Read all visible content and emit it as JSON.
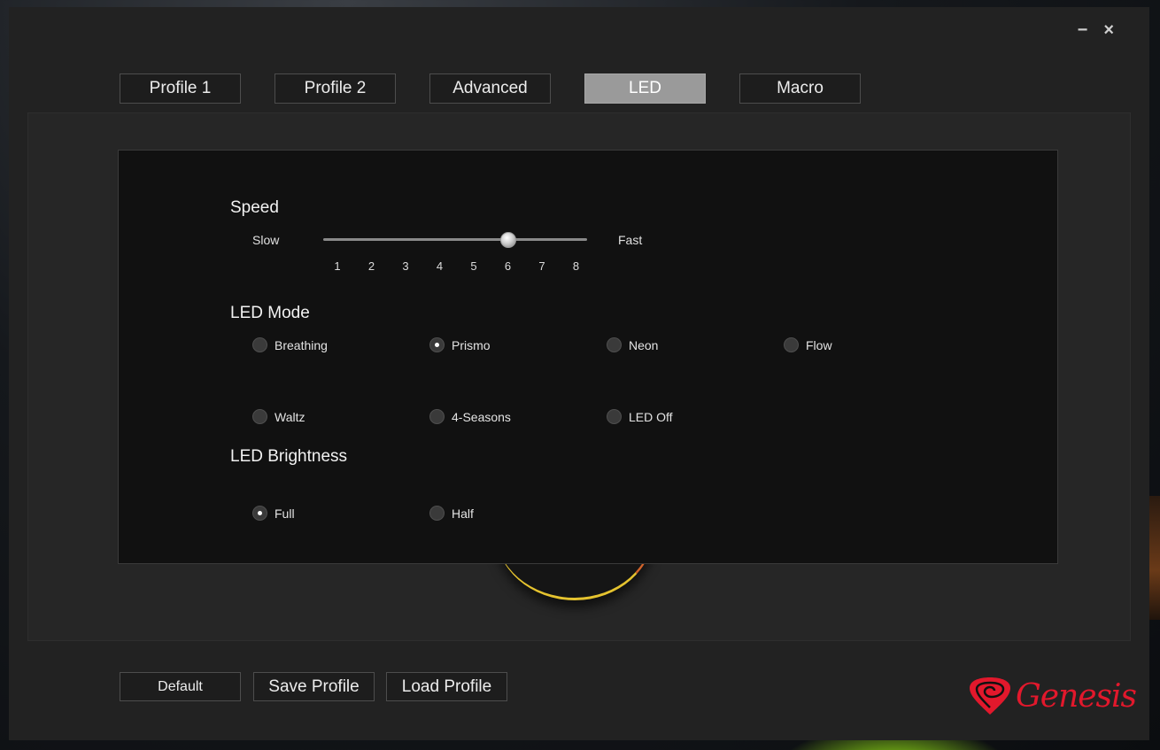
{
  "window": {
    "minimize_label": "−",
    "close_label": "×"
  },
  "tabs": [
    {
      "label": "Profile 1"
    },
    {
      "label": "Profile 2"
    },
    {
      "label": "Advanced"
    },
    {
      "label": "LED",
      "active": true
    },
    {
      "label": "Macro"
    }
  ],
  "speed": {
    "title": "Speed",
    "min_label": "Slow",
    "max_label": "Fast",
    "ticks": [
      "1",
      "2",
      "3",
      "4",
      "5",
      "6",
      "7",
      "8"
    ],
    "value": 6
  },
  "led_mode": {
    "title": "LED Mode",
    "options": [
      {
        "label": "Breathing",
        "checked": false
      },
      {
        "label": "Prismo",
        "checked": true
      },
      {
        "label": "Neon",
        "checked": false
      },
      {
        "label": "Flow",
        "checked": false
      },
      {
        "label": "Waltz",
        "checked": false
      },
      {
        "label": "4-Seasons",
        "checked": false
      },
      {
        "label": "LED Off",
        "checked": false
      }
    ]
  },
  "led_brightness": {
    "title": "LED Brightness",
    "options": [
      {
        "label": "Full",
        "checked": true
      },
      {
        "label": "Half",
        "checked": false
      }
    ]
  },
  "footer": {
    "default_label": "Default",
    "save_label": "Save Profile",
    "load_label": "Load Profile"
  },
  "brand": {
    "logo_text": "Genesis",
    "color": "#e2182c"
  }
}
